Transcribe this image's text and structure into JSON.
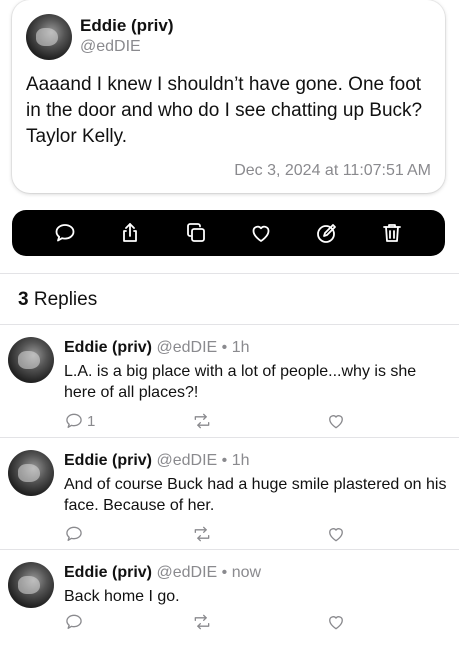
{
  "post": {
    "author_name": "Eddie (priv)",
    "author_handle": "@edDIE",
    "text": "Aaaand I knew I shouldn’t have gone. One foot in the door and who do I see chatting up Buck? Taylor Kelly.",
    "timestamp": "Dec 3, 2024 at 11:07:51 AM"
  },
  "action_bar": {
    "icons": [
      "comment-icon",
      "share-icon",
      "copy-icon",
      "heart-icon",
      "edit-icon",
      "trash-icon"
    ]
  },
  "replies_section": {
    "count": "3",
    "label": "Replies"
  },
  "replies": [
    {
      "author_name": "Eddie (priv)",
      "author_handle": "@edDIE",
      "separator": "•",
      "age": "1h",
      "text": "L.A. is a big place with a lot of people...why is she here of all places?!",
      "comment_count": "1"
    },
    {
      "author_name": "Eddie (priv)",
      "author_handle": "@edDIE",
      "separator": "•",
      "age": "1h",
      "text": "And of course Buck had a huge smile plastered on his face. Because of her.",
      "comment_count": ""
    },
    {
      "author_name": "Eddie (priv)",
      "author_handle": "@edDIE",
      "separator": "•",
      "age": "now",
      "text": "Back home I go.",
      "comment_count": ""
    }
  ]
}
